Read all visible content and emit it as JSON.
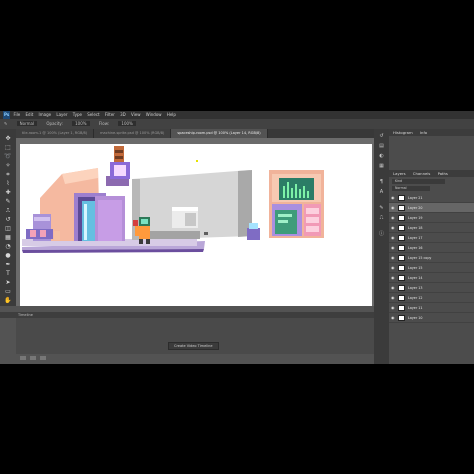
{
  "menubar": {
    "logo": "Ps",
    "items": [
      "File",
      "Edit",
      "Image",
      "Layer",
      "Type",
      "Select",
      "Filter",
      "3D",
      "View",
      "Window",
      "Help"
    ]
  },
  "options": {
    "items": [
      "Opacity:",
      "100%",
      "Flow:",
      "100%"
    ],
    "mode_value": "Normal"
  },
  "tabs": [
    {
      "label": "tile-room-1 @ 100% (Layer 1, RGB/8)"
    },
    {
      "label": "machine-sprite.psd @ 100% (RGB/8)"
    },
    {
      "label": "spaceship-room.psd @ 100% (Layer 14, RGB/8)",
      "active": true
    }
  ],
  "status": {
    "text": "100%   Doc: 1.20M/9.4M"
  },
  "timeline": {
    "tabs": [
      "Timeline"
    ],
    "create_button": "Create Video Timeline"
  },
  "panels": {
    "top_tabs": [
      "Histogram",
      "Info"
    ],
    "layers_tabs": [
      "Layers",
      "Channels",
      "Paths"
    ],
    "blend_mode": "Normal",
    "kind": "Kind",
    "layers": [
      {
        "name": "Layer 21"
      },
      {
        "name": "Layer 20",
        "selected": true
      },
      {
        "name": "Layer 19"
      },
      {
        "name": "Layer 18"
      },
      {
        "name": "Layer 17"
      },
      {
        "name": "Layer 16"
      },
      {
        "name": "Layer 15 copy"
      },
      {
        "name": "Layer 15"
      },
      {
        "name": "Layer 14"
      },
      {
        "name": "Layer 13"
      },
      {
        "name": "Layer 12"
      },
      {
        "name": "Layer 11"
      },
      {
        "name": "Layer 10"
      }
    ]
  },
  "colors": {
    "accent": "#31a8ff",
    "foreground": "#000000",
    "background": "#ffffff"
  }
}
